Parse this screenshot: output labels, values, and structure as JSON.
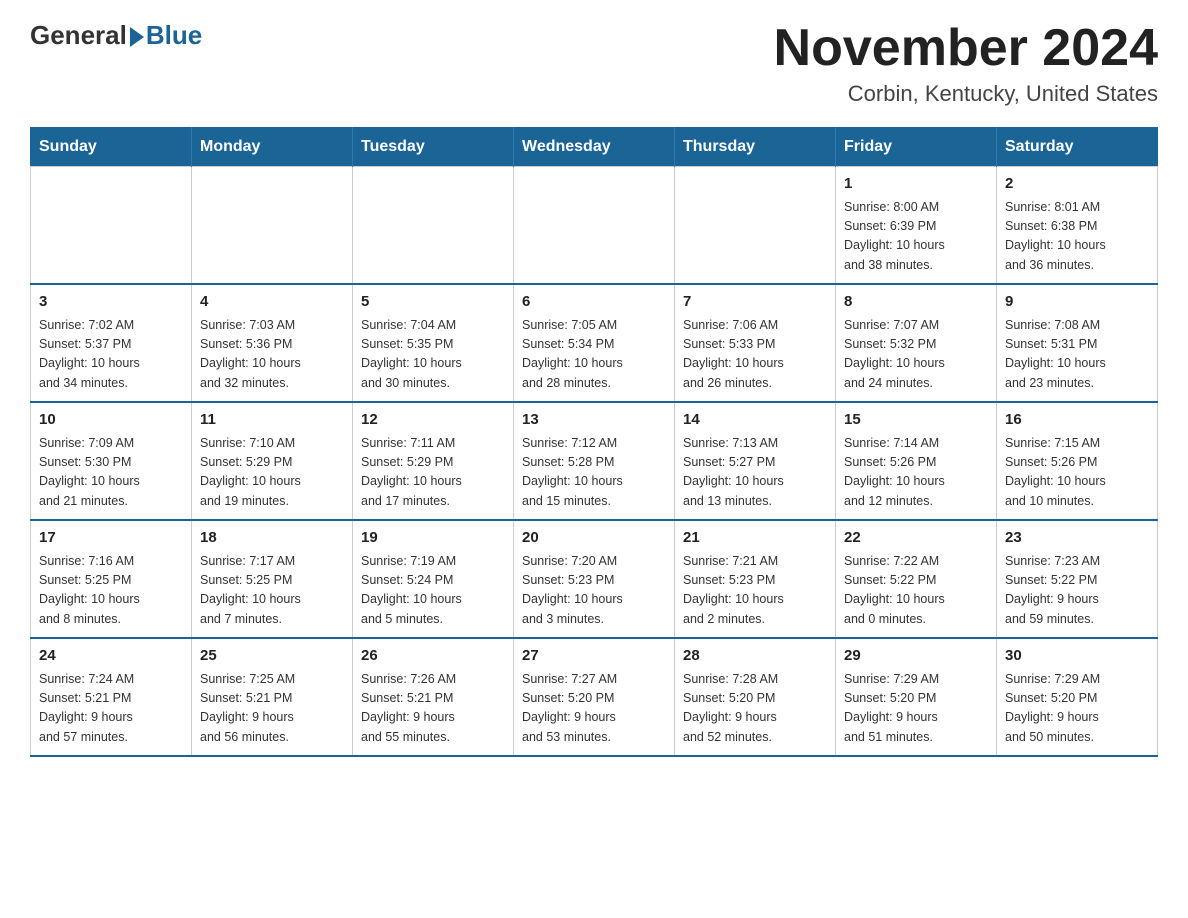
{
  "logo": {
    "general": "General",
    "blue": "Blue"
  },
  "title": "November 2024",
  "location": "Corbin, Kentucky, United States",
  "days_of_week": [
    "Sunday",
    "Monday",
    "Tuesday",
    "Wednesday",
    "Thursday",
    "Friday",
    "Saturday"
  ],
  "weeks": [
    [
      {
        "day": "",
        "info": ""
      },
      {
        "day": "",
        "info": ""
      },
      {
        "day": "",
        "info": ""
      },
      {
        "day": "",
        "info": ""
      },
      {
        "day": "",
        "info": ""
      },
      {
        "day": "1",
        "info": "Sunrise: 8:00 AM\nSunset: 6:39 PM\nDaylight: 10 hours\nand 38 minutes."
      },
      {
        "day": "2",
        "info": "Sunrise: 8:01 AM\nSunset: 6:38 PM\nDaylight: 10 hours\nand 36 minutes."
      }
    ],
    [
      {
        "day": "3",
        "info": "Sunrise: 7:02 AM\nSunset: 5:37 PM\nDaylight: 10 hours\nand 34 minutes."
      },
      {
        "day": "4",
        "info": "Sunrise: 7:03 AM\nSunset: 5:36 PM\nDaylight: 10 hours\nand 32 minutes."
      },
      {
        "day": "5",
        "info": "Sunrise: 7:04 AM\nSunset: 5:35 PM\nDaylight: 10 hours\nand 30 minutes."
      },
      {
        "day": "6",
        "info": "Sunrise: 7:05 AM\nSunset: 5:34 PM\nDaylight: 10 hours\nand 28 minutes."
      },
      {
        "day": "7",
        "info": "Sunrise: 7:06 AM\nSunset: 5:33 PM\nDaylight: 10 hours\nand 26 minutes."
      },
      {
        "day": "8",
        "info": "Sunrise: 7:07 AM\nSunset: 5:32 PM\nDaylight: 10 hours\nand 24 minutes."
      },
      {
        "day": "9",
        "info": "Sunrise: 7:08 AM\nSunset: 5:31 PM\nDaylight: 10 hours\nand 23 minutes."
      }
    ],
    [
      {
        "day": "10",
        "info": "Sunrise: 7:09 AM\nSunset: 5:30 PM\nDaylight: 10 hours\nand 21 minutes."
      },
      {
        "day": "11",
        "info": "Sunrise: 7:10 AM\nSunset: 5:29 PM\nDaylight: 10 hours\nand 19 minutes."
      },
      {
        "day": "12",
        "info": "Sunrise: 7:11 AM\nSunset: 5:29 PM\nDaylight: 10 hours\nand 17 minutes."
      },
      {
        "day": "13",
        "info": "Sunrise: 7:12 AM\nSunset: 5:28 PM\nDaylight: 10 hours\nand 15 minutes."
      },
      {
        "day": "14",
        "info": "Sunrise: 7:13 AM\nSunset: 5:27 PM\nDaylight: 10 hours\nand 13 minutes."
      },
      {
        "day": "15",
        "info": "Sunrise: 7:14 AM\nSunset: 5:26 PM\nDaylight: 10 hours\nand 12 minutes."
      },
      {
        "day": "16",
        "info": "Sunrise: 7:15 AM\nSunset: 5:26 PM\nDaylight: 10 hours\nand 10 minutes."
      }
    ],
    [
      {
        "day": "17",
        "info": "Sunrise: 7:16 AM\nSunset: 5:25 PM\nDaylight: 10 hours\nand 8 minutes."
      },
      {
        "day": "18",
        "info": "Sunrise: 7:17 AM\nSunset: 5:25 PM\nDaylight: 10 hours\nand 7 minutes."
      },
      {
        "day": "19",
        "info": "Sunrise: 7:19 AM\nSunset: 5:24 PM\nDaylight: 10 hours\nand 5 minutes."
      },
      {
        "day": "20",
        "info": "Sunrise: 7:20 AM\nSunset: 5:23 PM\nDaylight: 10 hours\nand 3 minutes."
      },
      {
        "day": "21",
        "info": "Sunrise: 7:21 AM\nSunset: 5:23 PM\nDaylight: 10 hours\nand 2 minutes."
      },
      {
        "day": "22",
        "info": "Sunrise: 7:22 AM\nSunset: 5:22 PM\nDaylight: 10 hours\nand 0 minutes."
      },
      {
        "day": "23",
        "info": "Sunrise: 7:23 AM\nSunset: 5:22 PM\nDaylight: 9 hours\nand 59 minutes."
      }
    ],
    [
      {
        "day": "24",
        "info": "Sunrise: 7:24 AM\nSunset: 5:21 PM\nDaylight: 9 hours\nand 57 minutes."
      },
      {
        "day": "25",
        "info": "Sunrise: 7:25 AM\nSunset: 5:21 PM\nDaylight: 9 hours\nand 56 minutes."
      },
      {
        "day": "26",
        "info": "Sunrise: 7:26 AM\nSunset: 5:21 PM\nDaylight: 9 hours\nand 55 minutes."
      },
      {
        "day": "27",
        "info": "Sunrise: 7:27 AM\nSunset: 5:20 PM\nDaylight: 9 hours\nand 53 minutes."
      },
      {
        "day": "28",
        "info": "Sunrise: 7:28 AM\nSunset: 5:20 PM\nDaylight: 9 hours\nand 52 minutes."
      },
      {
        "day": "29",
        "info": "Sunrise: 7:29 AM\nSunset: 5:20 PM\nDaylight: 9 hours\nand 51 minutes."
      },
      {
        "day": "30",
        "info": "Sunrise: 7:29 AM\nSunset: 5:20 PM\nDaylight: 9 hours\nand 50 minutes."
      }
    ]
  ]
}
